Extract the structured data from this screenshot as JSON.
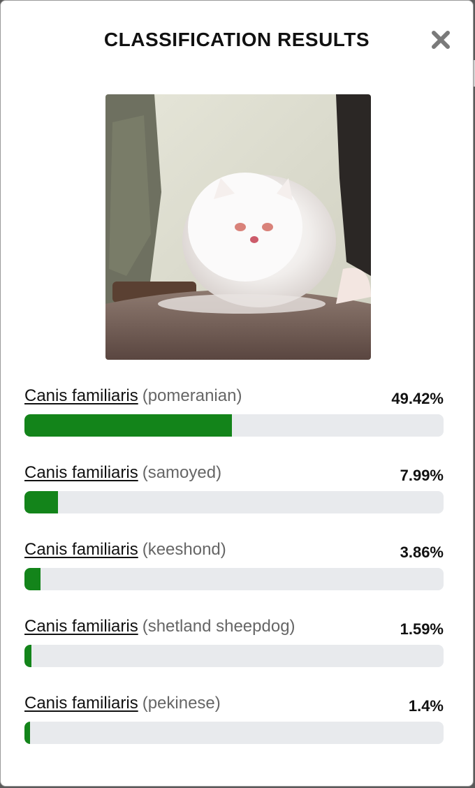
{
  "modal": {
    "title": "CLASSIFICATION RESULTS",
    "close_icon": "close-x-icon",
    "image_alt": "fluffy white persian cat sitting on a cushion"
  },
  "colors": {
    "bar_fill": "#13841a",
    "bar_track": "#e8eaed"
  },
  "results": [
    {
      "species": "Canis familiaris",
      "breed": "(pomeranian)",
      "percent_label": "49.42%",
      "value": 49.42
    },
    {
      "species": "Canis familiaris",
      "breed": "(samoyed)",
      "percent_label": "7.99%",
      "value": 7.99
    },
    {
      "species": "Canis familiaris",
      "breed": "(keeshond)",
      "percent_label": "3.86%",
      "value": 3.86
    },
    {
      "species": "Canis familiaris",
      "breed": "(shetland sheepdog)",
      "percent_label": "1.59%",
      "value": 1.59
    },
    {
      "species": "Canis familiaris",
      "breed": "(pekinese)",
      "percent_label": "1.4%",
      "value": 1.4
    }
  ]
}
